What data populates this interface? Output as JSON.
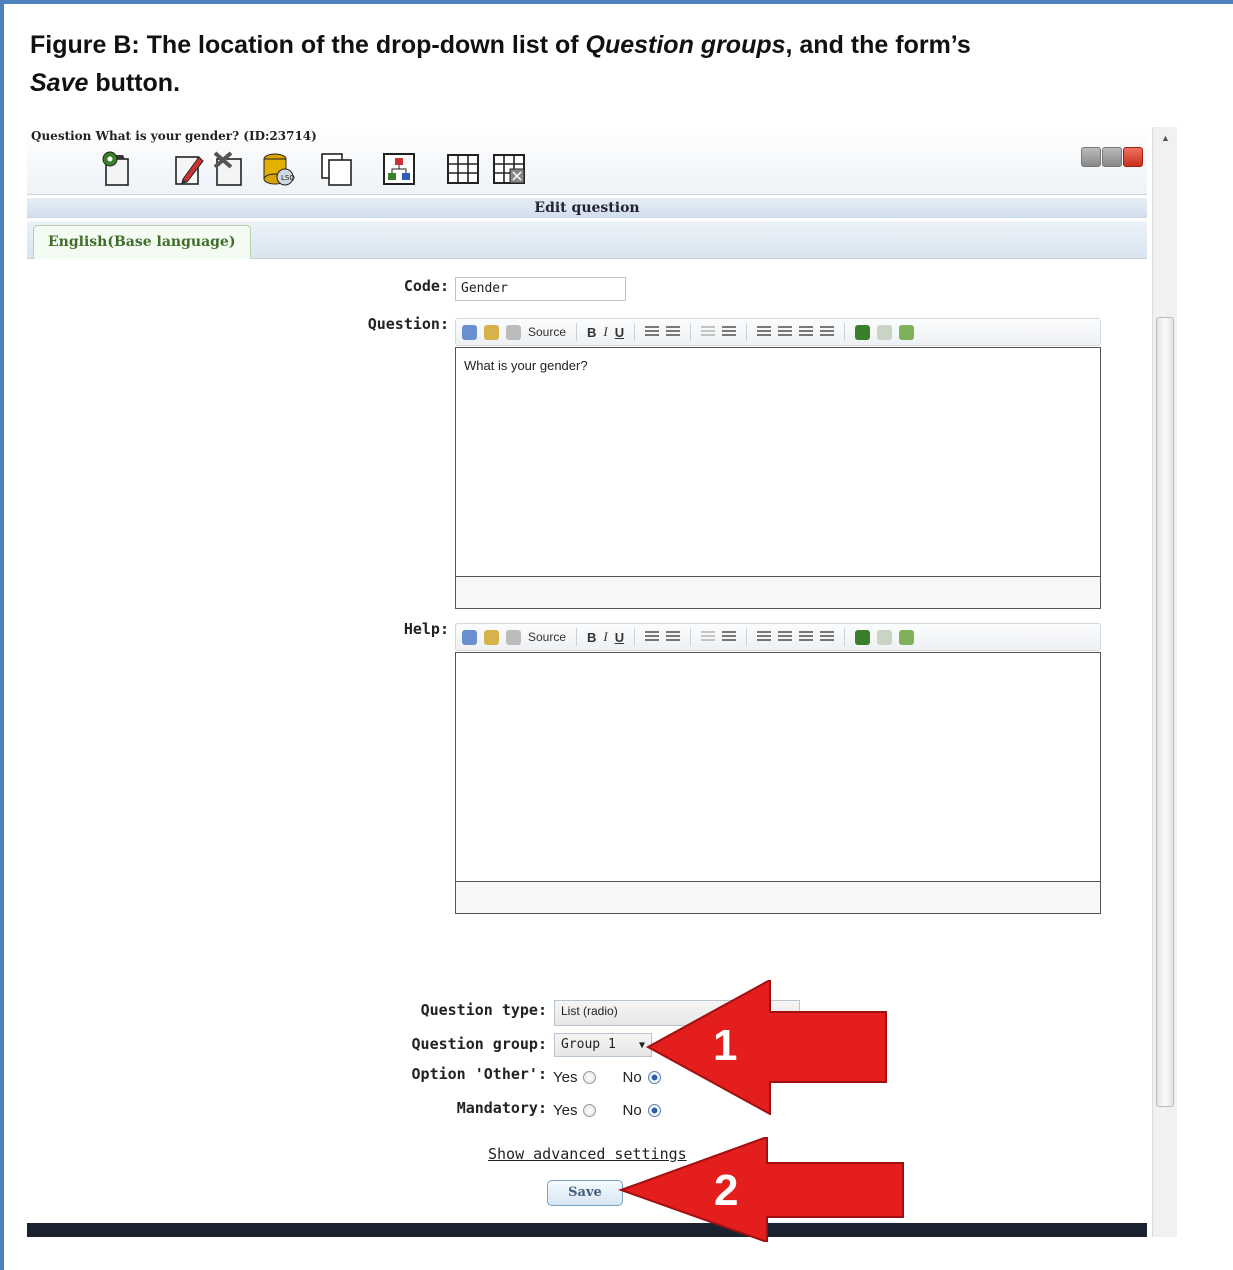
{
  "figure": {
    "caption_prefix": "Figure B:  The location of the drop-down list of ",
    "caption_emph1": "Question groups",
    "caption_mid": ", and the form’s ",
    "caption_emph2": "Save",
    "caption_suffix": " button."
  },
  "window": {
    "title": "Question What is your gender? (ID:23714)",
    "panel_title": "Edit question",
    "tab_label": "English(Base language)"
  },
  "toolbar_icons": [
    "question-settings-icon",
    "edit-icon",
    "delete-icon",
    "export-lsq-icon",
    "copy-icon",
    "conditions-icon",
    "answer-grid-icon",
    "subquestion-grid-icon"
  ],
  "form": {
    "code_label": "Code:",
    "code_value": "Gender",
    "question_label": "Question:",
    "question_text": "What is your gender?",
    "help_label": "Help:",
    "help_text": "",
    "source_label": "Source",
    "bold": "B",
    "italic": "I",
    "underline": "U",
    "question_type_label": "Question type:",
    "question_type_value": "List (radio)",
    "question_group_label": "Question group:",
    "question_group_value": "Group 1",
    "option_other_label": "Option 'Other':",
    "mandatory_label": "Mandatory:",
    "yes": "Yes",
    "no": "No",
    "option_other_selected": "No",
    "mandatory_selected": "No",
    "advanced_link": "Show advanced settings",
    "save_label": "Save"
  },
  "annotations": {
    "arrow1_number": "1",
    "arrow2_number": "2",
    "arrow_color": "#e41d1d"
  },
  "colors": {
    "frame_border": "#4f81bd",
    "tab_text": "#3f6e2a"
  }
}
